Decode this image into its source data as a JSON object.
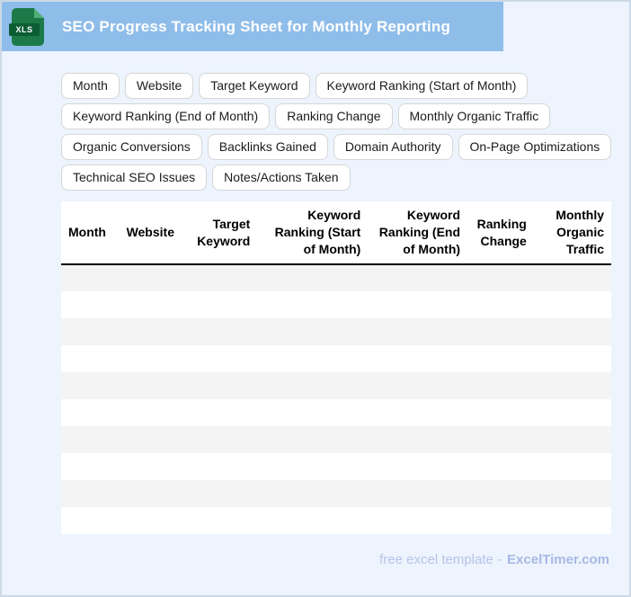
{
  "header": {
    "title": "SEO Progress Tracking Sheet for Monthly Reporting",
    "file_badge": "XLS"
  },
  "tags": {
    "rows": [
      [
        "Month",
        "Website",
        "Target Keyword",
        "Keyword Ranking (Start of Month)"
      ],
      [
        "Keyword Ranking (End of Month)",
        "Ranking Change",
        "Monthly Organic Traffic"
      ],
      [
        "Organic Conversions",
        "Backlinks Gained",
        "Domain Authority",
        "On-Page Optimizations"
      ],
      [
        "Technical SEO Issues",
        "Notes/Actions Taken"
      ]
    ]
  },
  "table": {
    "columns": [
      {
        "label": "Month",
        "align": "left",
        "width": "10.5%"
      },
      {
        "label": "Website",
        "align": "left",
        "width": "11.5%"
      },
      {
        "label": "Target Keyword",
        "align": "right",
        "width": "13.5%"
      },
      {
        "label": "Keyword Ranking (Start of Month)",
        "align": "right",
        "width": "20%"
      },
      {
        "label": "Keyword Ranking (End of Month)",
        "align": "right",
        "width": "18%"
      },
      {
        "label": "Ranking Change",
        "align": "right",
        "width": "12%"
      },
      {
        "label": "Monthly Organic Traffic",
        "align": "right",
        "width": "14%"
      }
    ],
    "empty_row_count": 10
  },
  "footer": {
    "prefix": "free excel template -",
    "brand": "ExcelTimer.com"
  },
  "colors": {
    "titlebar_bg": "#8fbde9",
    "page_bg": "#edf4fd",
    "page_border": "#ccd9e6",
    "icon_green": "#1b7a47",
    "icon_band_green": "#0c5d33",
    "row_stripe": "#f4f4f4",
    "footer_text": "#b7c3e9",
    "footer_brand": "#a9b8e6",
    "header_rule": "#000000"
  }
}
